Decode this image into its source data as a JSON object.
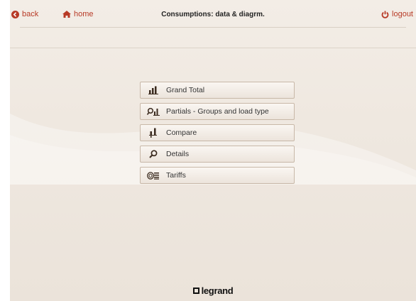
{
  "header": {
    "back_label": "back",
    "home_label": "home",
    "title": "Consumptions: data & diagrm.",
    "logout_label": "logout"
  },
  "menu": [
    {
      "label": "Grand Total",
      "icon": "bar-chart-icon"
    },
    {
      "label": "Partials - Groups and load type",
      "icon": "search-chart-icon"
    },
    {
      "label": "Compare",
      "icon": "compare-bars-icon"
    },
    {
      "label": "Details",
      "icon": "magnifier-icon"
    },
    {
      "label": "Tariffs",
      "icon": "coins-icon"
    }
  ],
  "footer": {
    "brand": "legrand"
  },
  "colors": {
    "accent": "#b73a26",
    "background": "#efe8e0"
  }
}
